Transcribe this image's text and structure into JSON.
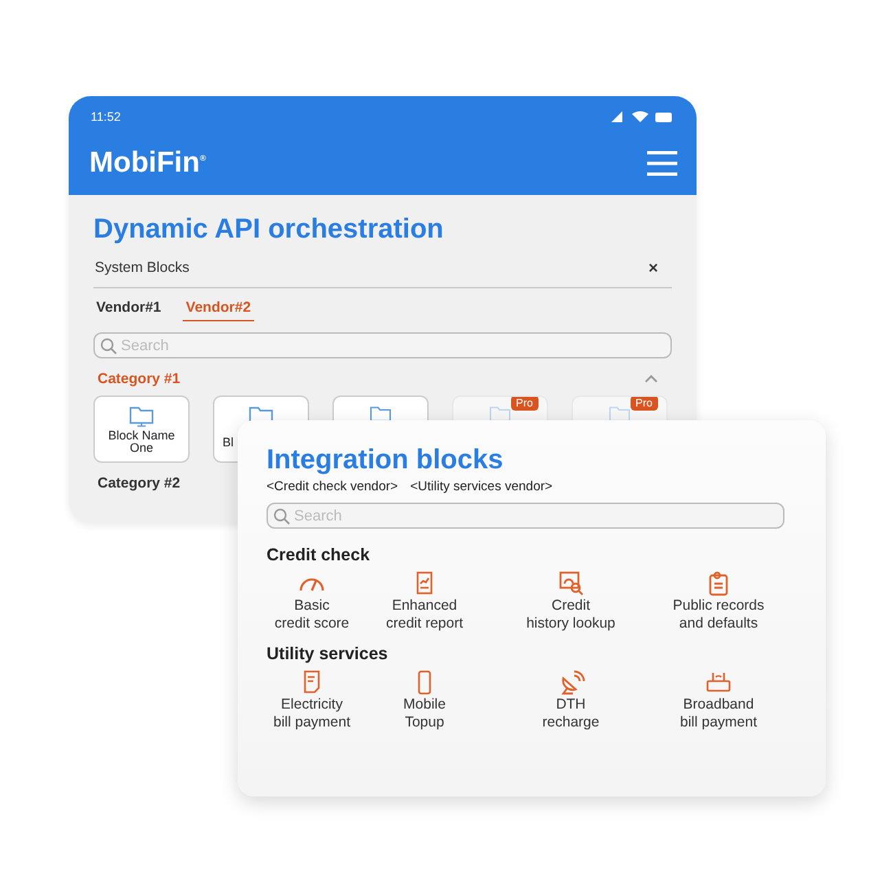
{
  "phone": {
    "status_bar": {
      "time": "11:52"
    },
    "header": {
      "logo": "MobiFin",
      "logo_mark": "®"
    },
    "title": "Dynamic API orchestration",
    "chip": {
      "label": "System Blocks",
      "close": "×"
    },
    "tabs": [
      {
        "label": "Vendor#1",
        "selected": false
      },
      {
        "label": "Vendor#2",
        "selected": true
      }
    ],
    "search": {
      "placeholder": "Search"
    },
    "categories": [
      {
        "label": "Category #1",
        "expanded": true,
        "blocks": [
          {
            "label": "Block Name One",
            "kind": "full",
            "pro": false
          },
          {
            "label": "Bl",
            "kind": "partial",
            "pro": false
          },
          {
            "kind": "hidden",
            "pro": false
          },
          {
            "kind": "hidden",
            "pro": true,
            "badge": "Pro"
          },
          {
            "kind": "hidden",
            "pro": true,
            "badge": "Pro"
          }
        ]
      },
      {
        "label": "Category #2",
        "expanded": false
      }
    ]
  },
  "panel": {
    "title": "Integration blocks",
    "vendors": [
      "<Credit check vendor>",
      "<Utility services vendor>"
    ],
    "search": {
      "placeholder": "Search"
    },
    "sections": [
      {
        "title": "Credit check",
        "items": [
          {
            "lines": [
              "Basic",
              "credit score"
            ],
            "kind": "gauge"
          },
          {
            "lines": [
              "Enhanced",
              "credit report"
            ],
            "kind": "report"
          },
          {
            "lines": [
              "Credit",
              "history lookup"
            ],
            "kind": "lookup"
          },
          {
            "lines": [
              "Public records",
              "and defaults"
            ],
            "kind": "records"
          }
        ]
      },
      {
        "title": "Utility services",
        "items": [
          {
            "lines": [
              "Electricity",
              "bill payment"
            ],
            "kind": "bill"
          },
          {
            "lines": [
              "Mobile",
              "Topup"
            ],
            "kind": "mobile"
          },
          {
            "lines": [
              "DTH",
              "recharge"
            ],
            "kind": "dish"
          },
          {
            "lines": [
              "Broadband",
              "bill payment"
            ],
            "kind": "router"
          }
        ]
      }
    ]
  }
}
